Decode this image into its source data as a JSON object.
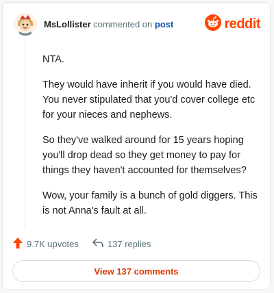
{
  "comment": {
    "username": "MsLollister",
    "action_text": "commented on",
    "post_link": "post",
    "paragraphs": [
      "NTA.",
      "They would have inherit if you would have died. You never stipulated that you'd cover college etc for your nieces and nephews.",
      "So they've walked around for 15 years hoping you'll drop dead so they get money to pay for things they haven't accounted for themselves?",
      "Wow, your family is a bunch of gold diggers. This is not Anna's fault at all."
    ],
    "upvotes": "9.7K upvotes",
    "replies": "137 replies"
  },
  "brand": {
    "wordmark": "reddit",
    "icon": "reddit-logo-icon",
    "color": "#ff4500"
  },
  "footer": {
    "view_comments_label": "View 137 comments"
  },
  "colors": {
    "accent": "#ff4500",
    "link": "#0f4fa8",
    "button_text": "#d93a00",
    "muted": "#576f76"
  },
  "icons": {
    "avatar": "avatar",
    "upvote": "upvote-arrow-icon",
    "reply": "reply-arrow-icon"
  }
}
